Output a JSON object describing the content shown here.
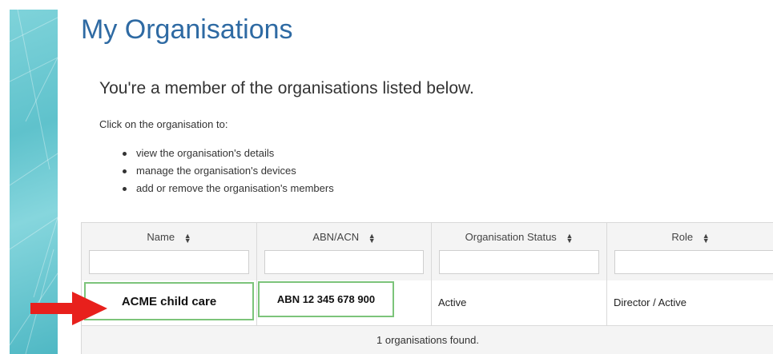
{
  "page": {
    "title": "My Organisations",
    "subtitle": "You're a member of the organisations listed below.",
    "intro": "Click on the organisation to:",
    "bullets": [
      "view the organisation's details",
      "manage the organisation's devices",
      "add or remove the organisation's members"
    ]
  },
  "table": {
    "columns": [
      {
        "label": "Name",
        "sort_icon": "sort-icon",
        "filter_value": ""
      },
      {
        "label": "ABN/ACN",
        "sort_icon": "sort-icon",
        "filter_value": ""
      },
      {
        "label": "Organisation Status",
        "sort_icon": "sort-icon",
        "filter_value": ""
      },
      {
        "label": "Role",
        "sort_icon": "sort-icon",
        "filter_value": ""
      }
    ],
    "rows": [
      {
        "name": "ACME child care",
        "abn": "ABN 12 345 678 900",
        "status": "Active",
        "role": "Director / Active"
      }
    ],
    "footer": "1 organisations found."
  },
  "colors": {
    "title": "#2e6aa3",
    "highlight_border": "#7cc47a",
    "arrow": "#e8201c",
    "header_bg": "#f4f4f4"
  },
  "icons": [
    "sort-icon",
    "arrow-right-icon"
  ]
}
